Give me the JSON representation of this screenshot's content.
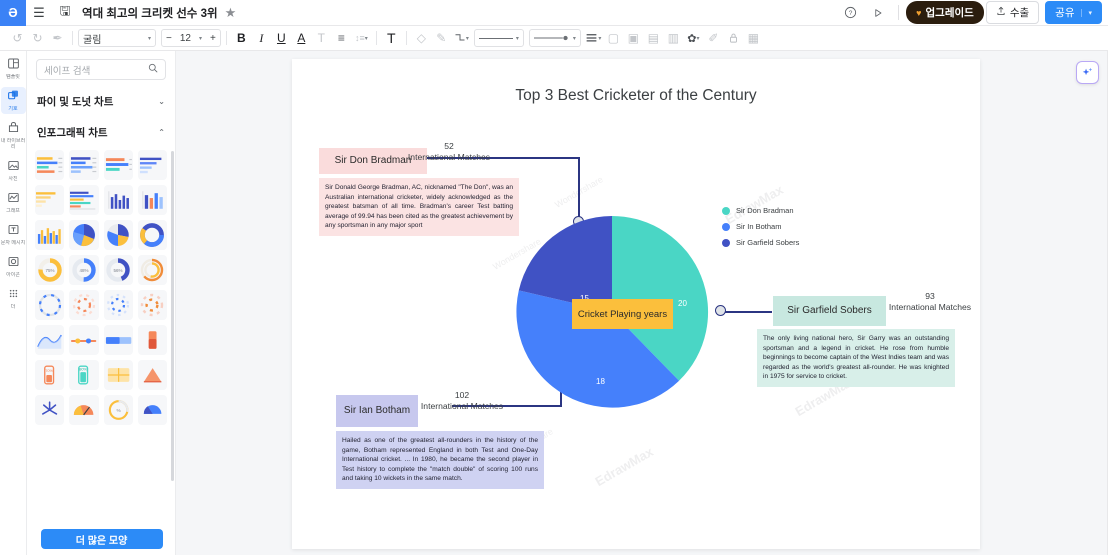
{
  "header": {
    "logo": "edraw-logo",
    "menu_icon": "hamburger-icon",
    "save_icon": "save-icon",
    "doc_title": "역대 최고의 크리켓 선수 3위",
    "star_icon": "★",
    "help_icon": "?",
    "present_icon": "▷",
    "upgrade_label": "업그레이드",
    "upgrade_icon": "♥",
    "export_label": "수출",
    "export_icon": "⇧",
    "share_label": "공유",
    "share_caret": "▾"
  },
  "toolbar": {
    "undo": "↺",
    "redo": "↻",
    "format_painter": "✒",
    "font_name": "굴림",
    "font_size": "12",
    "minus": "−",
    "plus": "+",
    "bold": "B",
    "italic": "I",
    "underline": "U",
    "font_color": "A",
    "strikethrough": "T",
    "align": "≡",
    "line_spacing": "↕≡",
    "text_tool": "T",
    "shape_fill": "◇",
    "pen": "✎",
    "connector": "⌐",
    "line_style": "—",
    "arrow_style": "→",
    "line_weight": "≡",
    "bring_front": "▢",
    "send_back": "▣",
    "align_objects": "▤",
    "group": "▥",
    "effects": "✿",
    "edit_shape": "✐",
    "lock": "🔒",
    "comment": "▦"
  },
  "rail": [
    {
      "icon": "template-icon",
      "glyph": "▣",
      "label": "템플릿",
      "active": false
    },
    {
      "icon": "symbol-icon",
      "glyph": "❑",
      "label": "기호",
      "active": true
    },
    {
      "icon": "library-icon",
      "glyph": "▤",
      "label": "내 라이브러리",
      "active": false
    },
    {
      "icon": "picture-icon",
      "glyph": "▨",
      "label": "사진",
      "active": false
    },
    {
      "icon": "graph-icon",
      "glyph": "⋀",
      "label": "그래프",
      "active": false
    },
    {
      "icon": "text-icon",
      "glyph": "T",
      "label": "문자 메시지",
      "active": false
    },
    {
      "icon": "ai-image-icon",
      "glyph": "◎",
      "label": "아이콘",
      "active": false
    },
    {
      "icon": "apps-icon",
      "glyph": "⠿",
      "label": "더",
      "active": false
    }
  ],
  "panel": {
    "search_placeholder": "세이프 검색",
    "search_icon": "search-icon",
    "sections": [
      {
        "title": "파이 및 도넛 차트",
        "expanded": false,
        "chevron": "⌄"
      },
      {
        "title": "인포그래픽 차트",
        "expanded": true,
        "chevron": "⌃"
      }
    ],
    "more_button": "더 많은 모양"
  },
  "canvas": {
    "ai_button_icon": "sparkle-icon",
    "page_title": "Top 3 Best Cricketer of the Century",
    "center_label": "Cricket Playing years",
    "watermarks": [
      "Wondershare",
      "EdrawMax",
      "Wondershare",
      "EdrawMax",
      "Wondershare",
      "EdrawMax"
    ]
  },
  "chart_data": {
    "type": "pie",
    "title": "Top 3 Best Cricketer of the Century",
    "center_label": "Cricket Playing years",
    "categories": [
      "Sir Don Bradman",
      "Sir In Botham",
      "Sir Garfield Sobers"
    ],
    "values": [
      20,
      18,
      15
    ],
    "colors": [
      "#4AD6C5",
      "#4580FB",
      "#4052C4"
    ],
    "legend_position": "right",
    "legend": [
      {
        "label": "Sir Don Bradman",
        "color": "#4AD6C5"
      },
      {
        "label": "Sir In Botham",
        "color": "#4580FB"
      },
      {
        "label": "Sir Garfield Sobers",
        "color": "#4052C4"
      }
    ],
    "slice_labels": [
      "20",
      "18",
      "15"
    ],
    "annotations": [
      {
        "name": "Sir Don Bradman",
        "matches_number": "52",
        "matches_label": "International Matches",
        "body": "Sir Donald George Bradman, AC, nicknamed \"The Don\", was an Australian international cricketer, widely acknowledged as the greatest batsman of all time. Bradman's career Test batting average of 99.94 has been cited as the greatest achievement by any sportsman in any major sport",
        "name_bg": "#fadcdc",
        "body_bg": "#fbe3e3"
      },
      {
        "name": "Sir Garfield Sobers",
        "matches_number": "93",
        "matches_label": "International Matches",
        "body": "The only living national hero, Sir Garry was an outstanding sportsman and a legend in cricket. He rose from humble beginnings to become captain of the West Indies team and was regarded as the world's greatest all-rounder. He was knighted in 1975 for service to cricket.",
        "name_bg": "#c8e8e0",
        "body_bg": "#d8efe9"
      },
      {
        "name": "Sir Ian Botham",
        "matches_number": "102",
        "matches_label": "International Matches",
        "body": "Hailed as one of the greatest all-rounders in the history of the game, Botham represented England in both Test and One-Day International cricket. ... In 1980, he became the second player in Test history to complete the \"match double\" of scoring 100 runs and taking 10 wickets in the same match.",
        "name_bg": "#c7c8ee",
        "body_bg": "#cfd2f2"
      }
    ]
  }
}
